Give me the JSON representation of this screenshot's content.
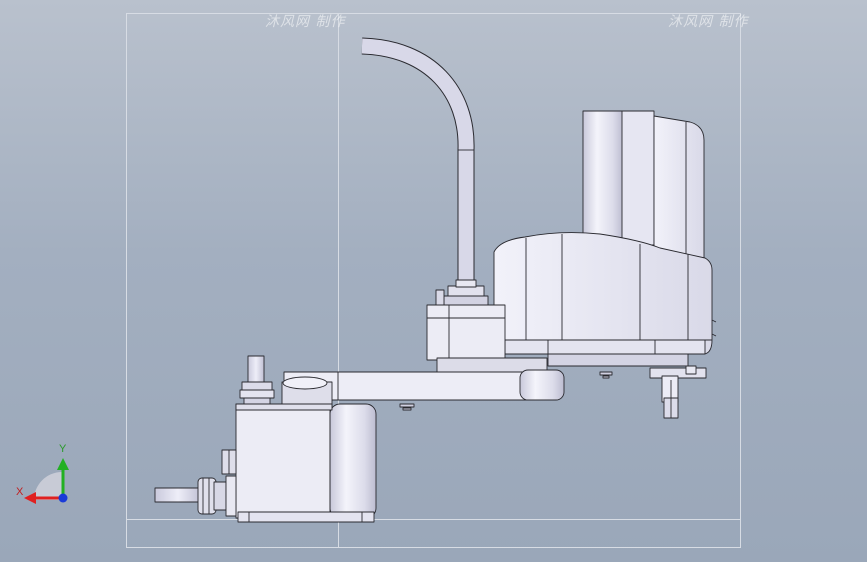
{
  "viewport": {
    "background_top": "#b9c1cd",
    "background_bottom": "#9aa7b9"
  },
  "watermarks": {
    "left": "沐风网 制作",
    "right": "沐风网 制作"
  },
  "triad": {
    "y_label": "Y",
    "x_label": "X",
    "y_color": "#22b022",
    "x_color": "#e02020",
    "z_color": "#1a3ad8"
  },
  "colors": {
    "part_light": "#eaeaf4",
    "part_mid": "#d6d6e6",
    "part_shadow": "#b8b8cc",
    "outline": "#2a2a30"
  },
  "icons": [
    "coordinate-triad-icon"
  ]
}
